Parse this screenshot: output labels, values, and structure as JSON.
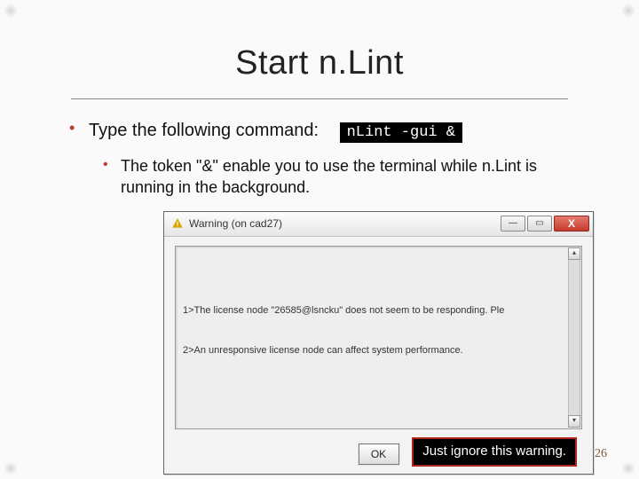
{
  "title": "Start n.Lint",
  "bullet1": "Type the following command:",
  "command": "nLint -gui &",
  "bullet2": "The token \"&\" enable you to use the terminal while n.Lint is running in the background.",
  "dialog": {
    "title": "Warning (on cad27)",
    "msg_line1": "1>The license node \"26585@lsncku\" does not seem to be responding. Ple",
    "msg_line2": "2>An unresponsive license node can affect system performance.",
    "ok": "OK"
  },
  "callout": "Just ignore this warning.",
  "page": "26"
}
